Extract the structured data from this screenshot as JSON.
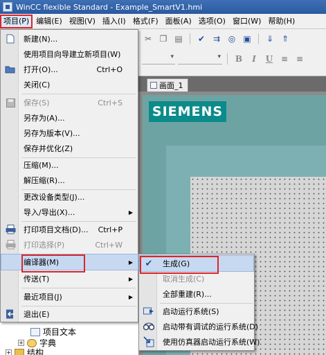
{
  "window": {
    "title": "WinCC flexible Standard - Example_SmartV1.hmi",
    "icon": "wincc-app-icon"
  },
  "menubar": [
    {
      "label": "项目(P)"
    },
    {
      "label": "编辑(E)"
    },
    {
      "label": "视图(V)"
    },
    {
      "label": "插入(I)"
    },
    {
      "label": "格式(F)"
    },
    {
      "label": "面板(A)"
    },
    {
      "label": "选项(O)"
    },
    {
      "label": "窗口(W)"
    },
    {
      "label": "帮助(H)"
    }
  ],
  "file_menu": {
    "items": [
      {
        "label": "新建(N)...",
        "icon": "new-document-icon",
        "shortcut": ""
      },
      {
        "label": "使用项目向导建立新项目(W)",
        "icon": "",
        "shortcut": ""
      },
      {
        "label": "打开(O)...",
        "icon": "open-folder-icon",
        "shortcut": "Ctrl+O"
      },
      {
        "label": "关闭(C)",
        "icon": "",
        "shortcut": ""
      },
      {
        "label": "保存(S)",
        "icon": "save-disk-icon",
        "shortcut": "Ctrl+S"
      },
      {
        "label": "另存为(A)...",
        "icon": "",
        "shortcut": ""
      },
      {
        "label": "另存为版本(V)...",
        "icon": "",
        "shortcut": ""
      },
      {
        "label": "保存并优化(Z)",
        "icon": "",
        "shortcut": ""
      },
      {
        "label": "压缩(M)...",
        "icon": "",
        "shortcut": ""
      },
      {
        "label": "解压缩(R)...",
        "icon": "",
        "shortcut": ""
      },
      {
        "label": "更改设备类型(J)...",
        "icon": "",
        "shortcut": ""
      },
      {
        "label": "导入/导出(X)...",
        "icon": "",
        "shortcut": ""
      },
      {
        "label": "打印项目文档(D)...",
        "icon": "printer-icon",
        "shortcut": "Ctrl+P"
      },
      {
        "label": "打印选择(P)",
        "icon": "printer-selection-icon",
        "shortcut": "Ctrl+W"
      },
      {
        "label": "编译器(M)",
        "icon": "",
        "shortcut": ""
      },
      {
        "label": "传送(T)",
        "icon": "",
        "shortcut": ""
      },
      {
        "label": "最近项目(J)",
        "icon": "",
        "shortcut": ""
      },
      {
        "label": "退出(E)",
        "icon": "exit-door-icon",
        "shortcut": ""
      }
    ]
  },
  "compiler_submenu": {
    "items": [
      {
        "label": "生成(G)",
        "icon": "checkmark-icon"
      },
      {
        "label": "取消生成(C)",
        "icon": ""
      },
      {
        "label": "全部重建(R)...",
        "icon": ""
      },
      {
        "label": "启动运行系统(S)",
        "icon": "start-runtime-icon"
      },
      {
        "label": "启动带有调试的运行系统(D)",
        "icon": "debug-runtime-icon"
      },
      {
        "label": "使用仿真器启动运行系统(W)",
        "icon": "simulator-runtime-icon"
      }
    ]
  },
  "editor": {
    "tab_label": "画面_1",
    "brand_logo": "SIEMENS"
  },
  "project_tree": {
    "items": [
      {
        "label": "项目文本"
      },
      {
        "label": "字典"
      },
      {
        "label": "结构"
      }
    ]
  },
  "colors": {
    "highlight_box": "#d8262a",
    "siemens_teal": "#0b8b8a",
    "menu_highlight": "#c7d9f0"
  }
}
